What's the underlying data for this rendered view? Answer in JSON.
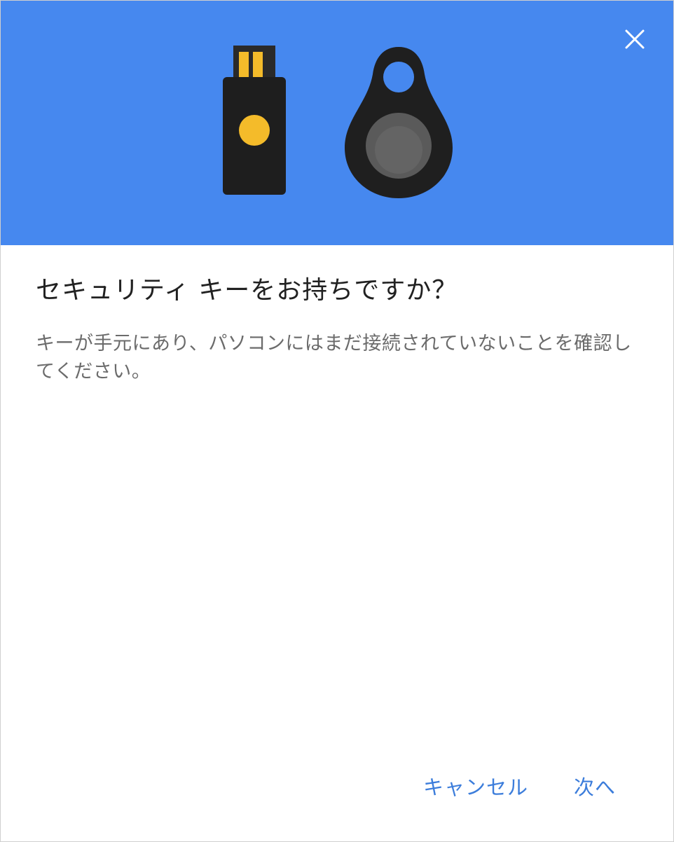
{
  "dialog": {
    "title": "セキュリティ キーをお持ちですか？",
    "body": "キーが手元にあり、パソコンにはまだ接続されていないことを確認してください。",
    "close_icon": "close-icon",
    "buttons": {
      "cancel_label": "キャンセル",
      "next_label": "次へ"
    }
  },
  "colors": {
    "hero_background": "#4688ef",
    "button_text": "#3c7ddb",
    "title_text": "#212121",
    "body_text": "#6b6b6b",
    "key_body": "#1e1e1e",
    "key_accent": "#f4bb2a"
  }
}
